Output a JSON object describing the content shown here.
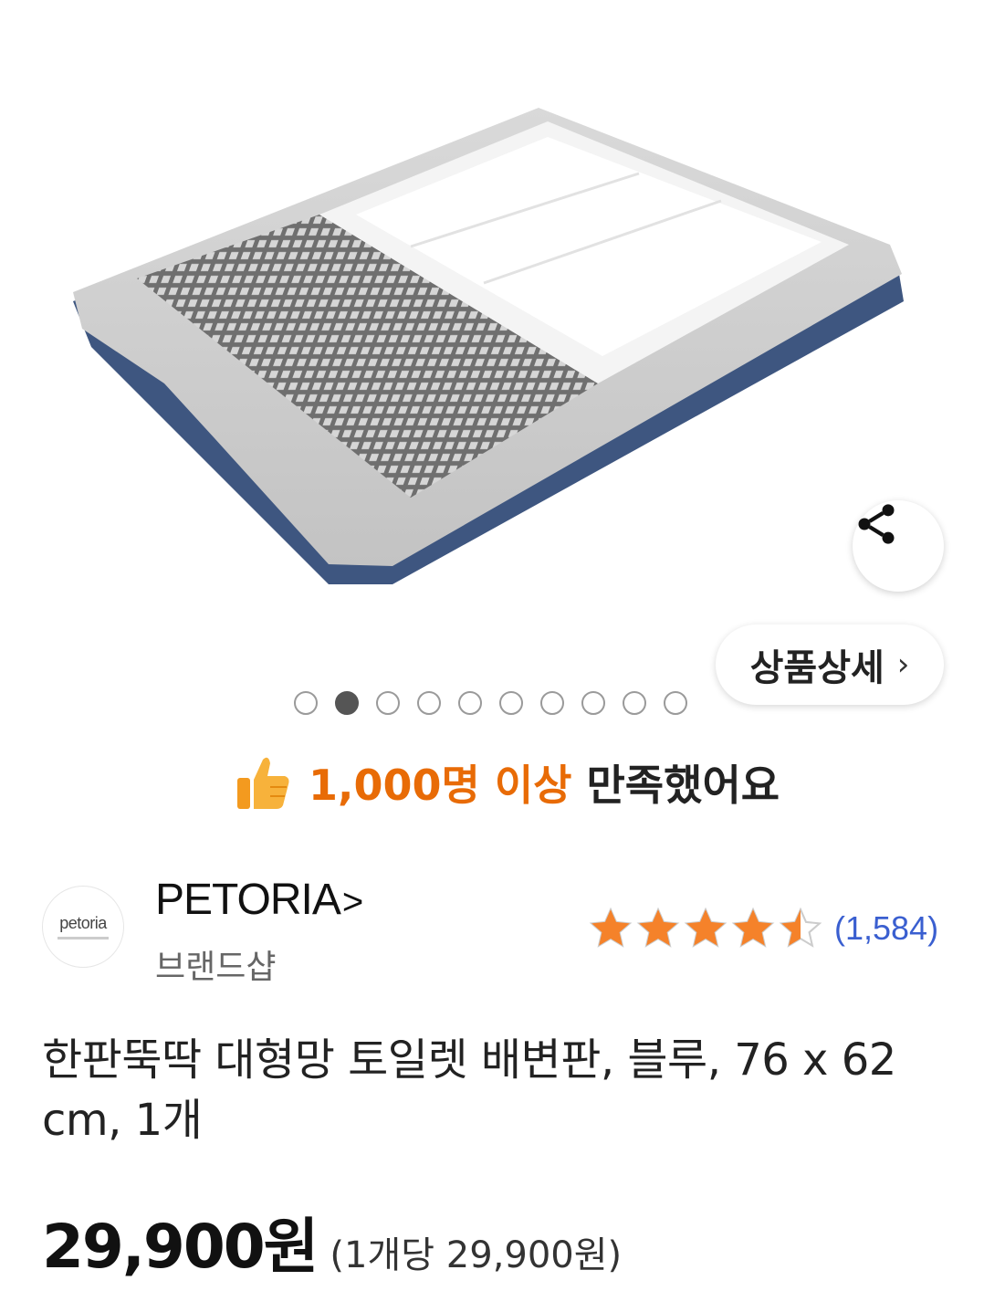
{
  "gallery": {
    "dots_total": 10,
    "active_index": 1,
    "detail_button_label": "상품상세",
    "detail_chevron": "›",
    "share_icon": "share-icon"
  },
  "satisfaction": {
    "icon": "thumbs-up-icon",
    "count_text": "1,000명 이상",
    "suffix_text": "만족했어요",
    "accent_color": "#e86b06"
  },
  "brand": {
    "logo_text": "petoria",
    "name": "PETORIA",
    "arrow": ">",
    "type": "브랜드샵"
  },
  "rating": {
    "stars": 4.5,
    "max": 5,
    "review_count": "(1,584)",
    "star_color": "#f5822a",
    "count_color": "#3a5fd0"
  },
  "product": {
    "title": "한판뚝딱 대형망 토일렛 배변판, 블루, 76 x 62 cm, 1개",
    "price": "29,900원",
    "unit_price": "(1개당 29,900원)"
  }
}
